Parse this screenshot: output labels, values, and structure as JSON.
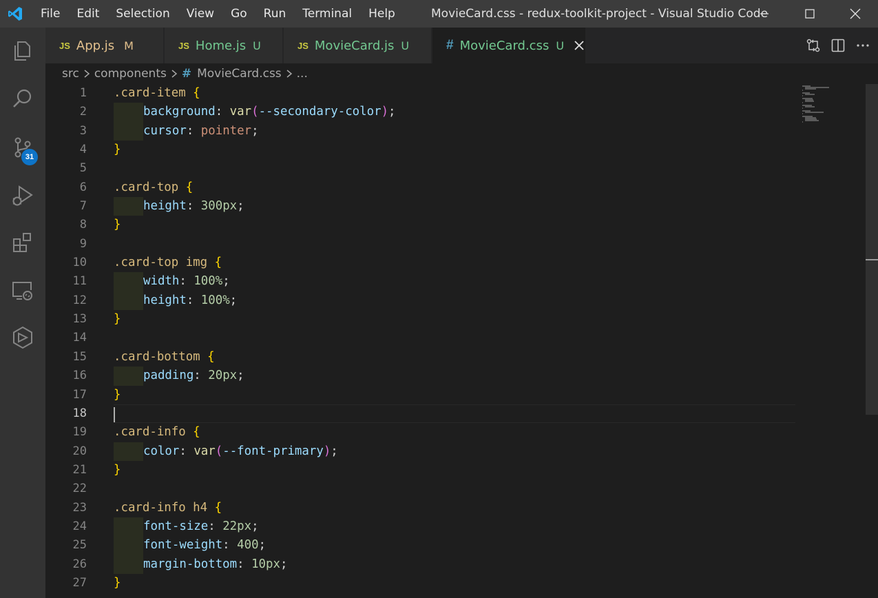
{
  "window": {
    "title": "MovieCard.css - redux-toolkit-project - Visual Studio Code",
    "menu": [
      "File",
      "Edit",
      "Selection",
      "View",
      "Go",
      "Run",
      "Terminal",
      "Help"
    ]
  },
  "activity_bar": {
    "items": [
      "explorer-icon",
      "search-icon",
      "source-control-icon",
      "run-debug-icon",
      "extensions-icon",
      "remote-explorer-icon",
      "deploy-icon"
    ],
    "source_control_badge": "31"
  },
  "tabs": [
    {
      "type_label": "JS",
      "name": "App.js",
      "status": "M",
      "active": false
    },
    {
      "type_label": "JS",
      "name": "Home.js",
      "status": "U",
      "active": false
    },
    {
      "type_label": "JS",
      "name": "MovieCard.js",
      "status": "U",
      "active": false
    },
    {
      "type_label": "#",
      "name": "MovieCard.css",
      "status": "U",
      "active": true
    }
  ],
  "breadcrumb": {
    "parts": [
      "src",
      "components"
    ],
    "file": "MovieCard.css",
    "trailing": "..."
  },
  "editor": {
    "current_line": 18,
    "line_numbers": [
      "1",
      "2",
      "3",
      "4",
      "5",
      "6",
      "7",
      "8",
      "9",
      "10",
      "11",
      "12",
      "13",
      "14",
      "15",
      "16",
      "17",
      "18",
      "19",
      "20",
      "21",
      "22",
      "23",
      "24",
      "25",
      "26",
      "27"
    ],
    "lines": [
      ".card-item {",
      "background: var(--secondary-color);",
      "cursor: pointer;",
      "}",
      "",
      ".card-top {",
      "height: 300px;",
      "}",
      "",
      ".card-top img {",
      "width: 100%;",
      "height: 100%;",
      "}",
      "",
      ".card-bottom {",
      "padding: 20px;",
      "}",
      "",
      ".card-info {",
      "color: var(--font-primary);",
      "}",
      "",
      ".card-info h4 {",
      "font-size: 22px;",
      "font-weight: 400;",
      "margin-bottom: 10px;",
      "}"
    ]
  },
  "colors": {
    "titlebar": "#3c3c3c",
    "activity_bar": "#333333",
    "editor_bg": "#1e1e1e",
    "badge": "#0e74c8"
  }
}
